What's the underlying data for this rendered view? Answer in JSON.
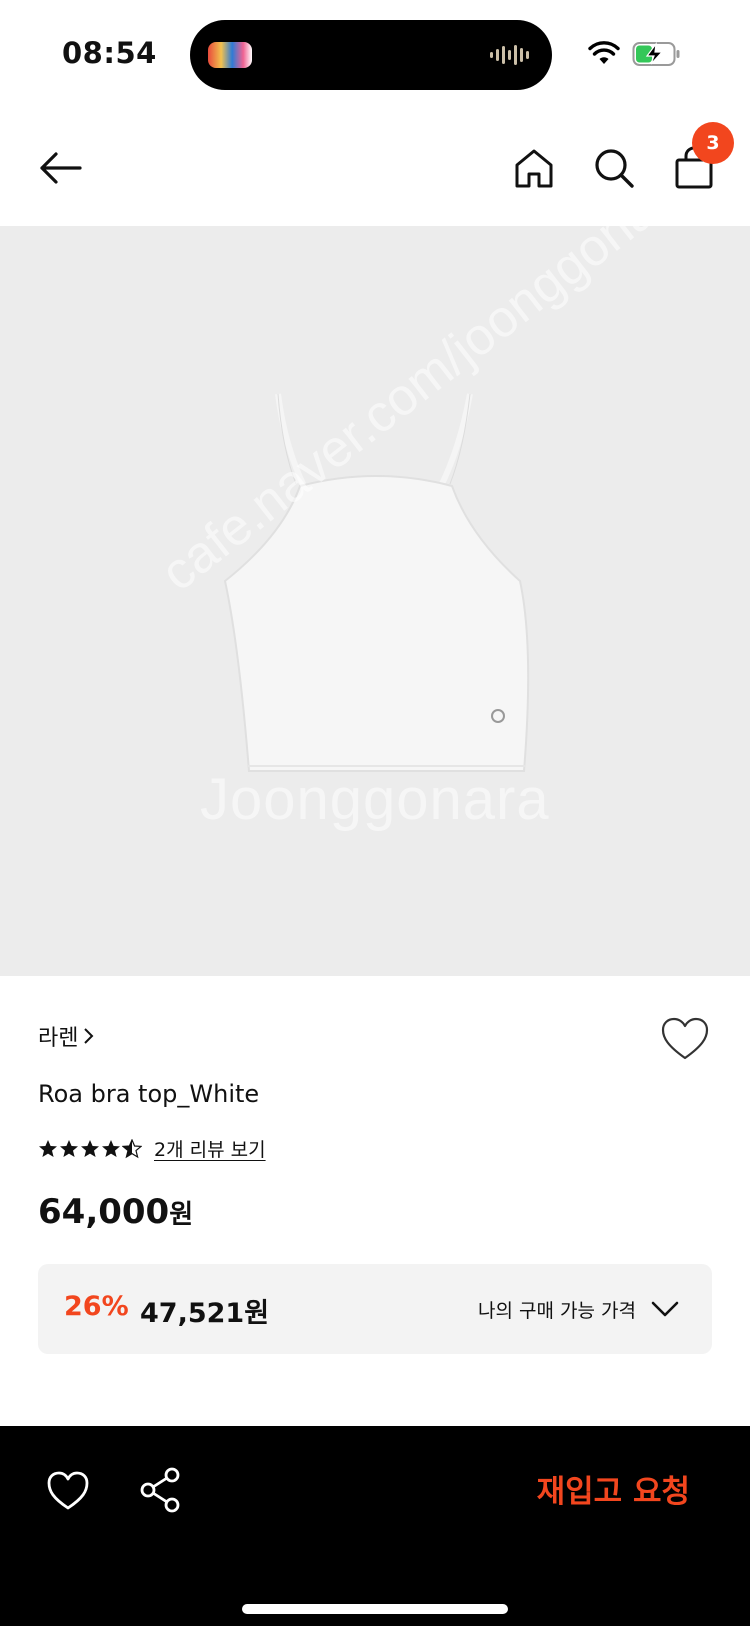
{
  "status_bar": {
    "time": "08:54"
  },
  "header": {
    "cart_count": "3"
  },
  "product": {
    "brand": "라렌",
    "title": "Roa bra top_White",
    "rating": 4.5,
    "review_link": "2개 리뷰 보기",
    "price": "64,000",
    "price_unit": "원",
    "watermark": "Joonggonara",
    "watermark_url": "cafe.naver.com/joonggonara"
  },
  "promo": {
    "discount": "26%",
    "price": "47,521원",
    "label": "나의 구매 가능 가격"
  },
  "bottom": {
    "restock_label": "재입고 요청"
  },
  "colors": {
    "accent": "#f2461e",
    "image_bg": "#ececec",
    "bottom_bg": "#000000"
  }
}
